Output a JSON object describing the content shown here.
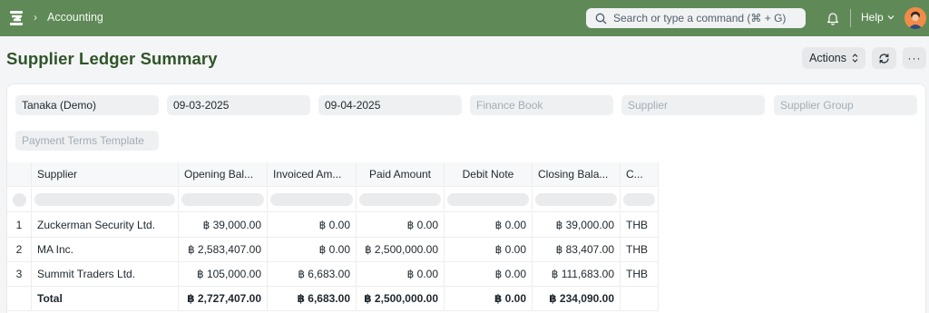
{
  "navbar": {
    "breadcrumb_separator": "›",
    "breadcrumb": "Accounting",
    "search_placeholder": "Search or type a command (⌘ + G)",
    "help_label": "Help",
    "help_chevron": "⌵"
  },
  "page": {
    "title": "Supplier Ledger Summary",
    "actions_label": "Actions",
    "actions_chevron": "⌃⌄",
    "more_label": "···"
  },
  "filters": {
    "company": "Tanaka (Demo)",
    "from_date": "09-03-2025",
    "to_date": "09-04-2025",
    "finance_book_placeholder": "Finance Book",
    "supplier_placeholder": "Supplier",
    "supplier_group_placeholder": "Supplier Group",
    "payment_terms_placeholder": "Payment Terms Template"
  },
  "table": {
    "columns": [
      "Supplier",
      "Opening Bal...",
      "Invoiced Am...",
      "Paid Amount",
      "Debit Note",
      "Closing Bala...",
      "C..."
    ],
    "rows": [
      {
        "index": "1",
        "supplier": "Zuckerman Security Ltd.",
        "opening": "฿ 39,000.00",
        "invoiced": "฿ 0.00",
        "paid": "฿ 0.00",
        "debit": "฿ 0.00",
        "closing": "฿ 39,000.00",
        "currency": "THB"
      },
      {
        "index": "2",
        "supplier": "MA Inc.",
        "opening": "฿ 2,583,407.00",
        "invoiced": "฿ 0.00",
        "paid": "฿ 2,500,000.00",
        "debit": "฿ 0.00",
        "closing": "฿ 83,407.00",
        "currency": "THB"
      },
      {
        "index": "3",
        "supplier": "Summit Traders Ltd.",
        "opening": "฿ 105,000.00",
        "invoiced": "฿ 6,683.00",
        "paid": "฿ 0.00",
        "debit": "฿ 0.00",
        "closing": "฿ 111,683.00",
        "currency": "THB"
      }
    ],
    "total": {
      "label": "Total",
      "opening": "฿ 2,727,407.00",
      "invoiced": "฿ 6,683.00",
      "paid": "฿ 2,500,000.00",
      "debit": "฿ 0.00",
      "closing": "฿ 234,090.00",
      "currency": ""
    }
  },
  "colors": {
    "navbar": "#5f8a57",
    "title": "#2f5429",
    "avatar": "#f08b48"
  },
  "icons": [
    "app-logo-icon",
    "search-icon",
    "bell-icon",
    "chevron-down-icon",
    "sort-icon",
    "refresh-icon",
    "more-icon"
  ]
}
